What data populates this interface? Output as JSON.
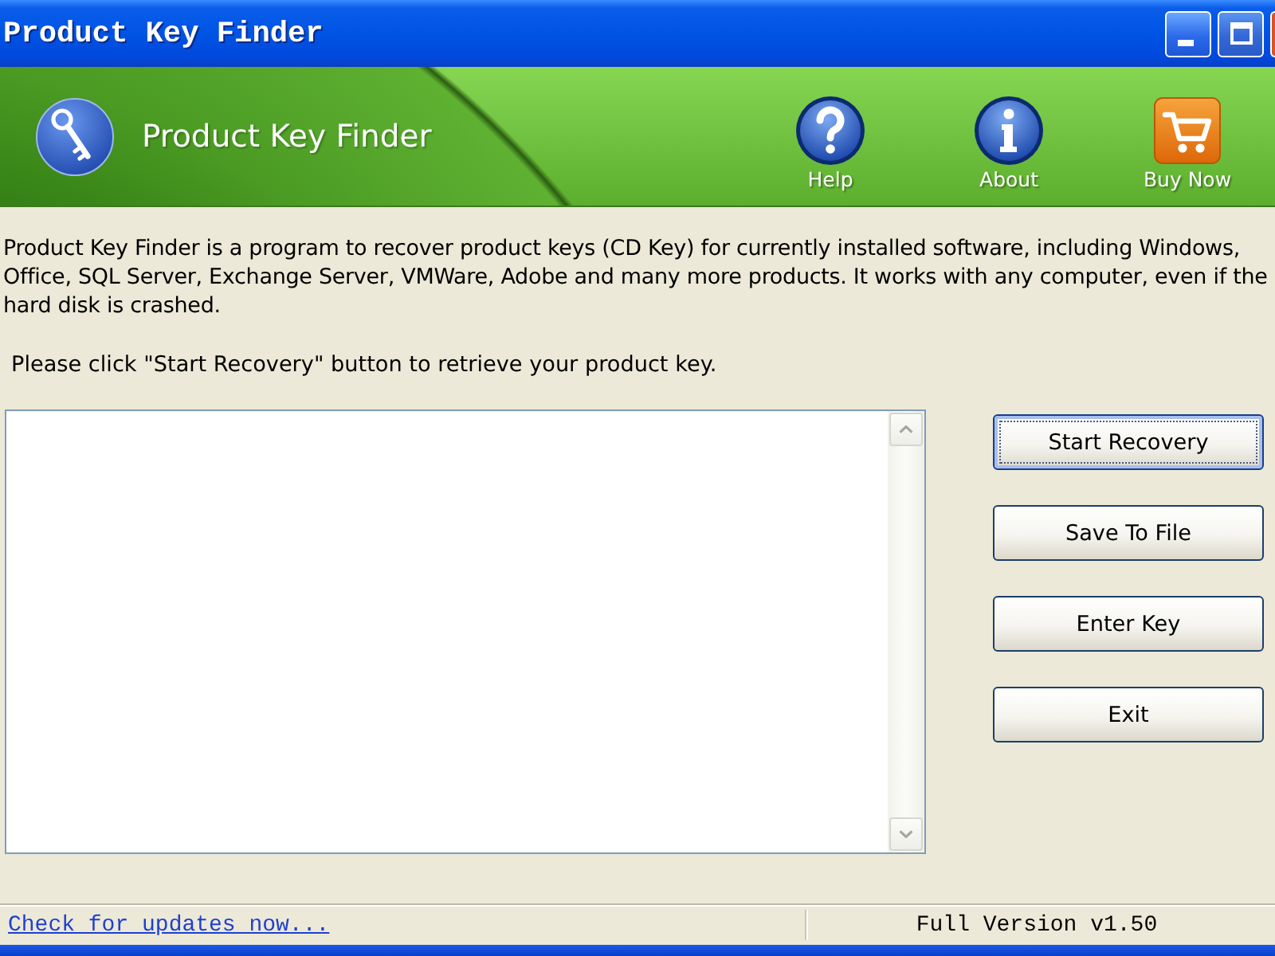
{
  "window": {
    "title": "Product Key Finder"
  },
  "header": {
    "app_name": "Product Key Finder",
    "buttons": [
      {
        "kind": "help",
        "label": "Help"
      },
      {
        "kind": "about",
        "label": "About"
      },
      {
        "kind": "cart",
        "label": "Buy Now"
      }
    ]
  },
  "description": "Product Key Finder is a program to recover product keys (CD Key) for currently installed software, including Windows, Office, SQL Server, Exchange Server, VMWare, Adobe and many more products. It works with any computer, even if the hard disk is crashed.",
  "instruction": "Please click \"Start Recovery\" button to retrieve your product key.",
  "actions": [
    {
      "label": "Start Recovery",
      "focused": true
    },
    {
      "label": "Save To File",
      "focused": false
    },
    {
      "label": "Enter Key",
      "focused": false
    },
    {
      "label": "Exit",
      "focused": false
    }
  ],
  "status_bar": {
    "link": "Check for updates now...",
    "version": "Full Version v1.50"
  }
}
